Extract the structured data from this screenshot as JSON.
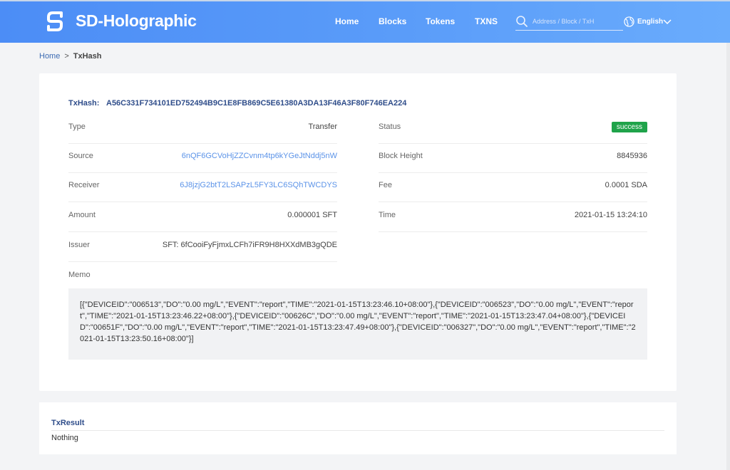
{
  "header": {
    "brand": "SD-Holographic",
    "nav": [
      "Home",
      "Blocks",
      "Tokens",
      "TXNS"
    ],
    "search_placeholder": "Address / Block / TxH",
    "language": "English",
    "gradient_colors": [
      "#4c8df6",
      "#6aacfc"
    ]
  },
  "breadcrumb": {
    "home": "Home",
    "separator": ">",
    "current": "TxHash"
  },
  "tx": {
    "hash_label": "TxHash:",
    "hash": "A56C331F734101ED752494B9C1E8FB869C5E61380A3DA13F46A3F80F746EA224",
    "left_rows": [
      {
        "label": "Type",
        "value": "Transfer"
      },
      {
        "label": "Source",
        "value": "6nQF6GCVoHjZZCvnm4tp6kYGeJtNddj5nW"
      },
      {
        "label": "Receiver",
        "value": "6J8jzjG2btT2LSAPzL5FY3LC6SQhTWCDYS"
      },
      {
        "label": "Amount",
        "value": "0.000001 SFT"
      },
      {
        "label": "Issuer",
        "value": "SFT:  6fCooiFyFjmxLCFh7iFR9H8HXXdMB3gQDE"
      }
    ],
    "right_rows": [
      {
        "label": "Status",
        "value": "success"
      },
      {
        "label": "Block Height",
        "value": "8845936"
      },
      {
        "label": "Fee",
        "value": "0.0001 SDA"
      },
      {
        "label": "Time",
        "value": "2021-01-15 13:24:10"
      }
    ],
    "memo_label": "Memo",
    "memo": "[{\"DEVICEID\":\"006513\",\"DO\":\"0.00 mg/L\",\"EVENT\":\"report\",\"TIME\":\"2021-01-15T13:23:46.10+08:00\"},{\"DEVICEID\":\"006523\",\"DO\":\"0.00 mg/L\",\"EVENT\":\"report\",\"TIME\":\"2021-01-15T13:23:46.22+08:00\"},{\"DEVICEID\":\"00626C\",\"DO\":\"0.00 mg/L\",\"EVENT\":\"report\",\"TIME\":\"2021-01-15T13:23:47.04+08:00\"},{\"DEVICEID\":\"00651F\",\"DO\":\"0.00 mg/L\",\"EVENT\":\"report\",\"TIME\":\"2021-01-15T13:23:47.49+08:00\"},{\"DEVICEID\":\"006327\",\"DO\":\"0.00 mg/L\",\"EVENT\":\"report\",\"TIME\":\"2021-01-15T13:23:50.16+08:00\"}]",
    "status_color": "#1fa34a",
    "link_color": "#5b93e8"
  },
  "result": {
    "title": "TxResult",
    "text": "Nothing"
  }
}
